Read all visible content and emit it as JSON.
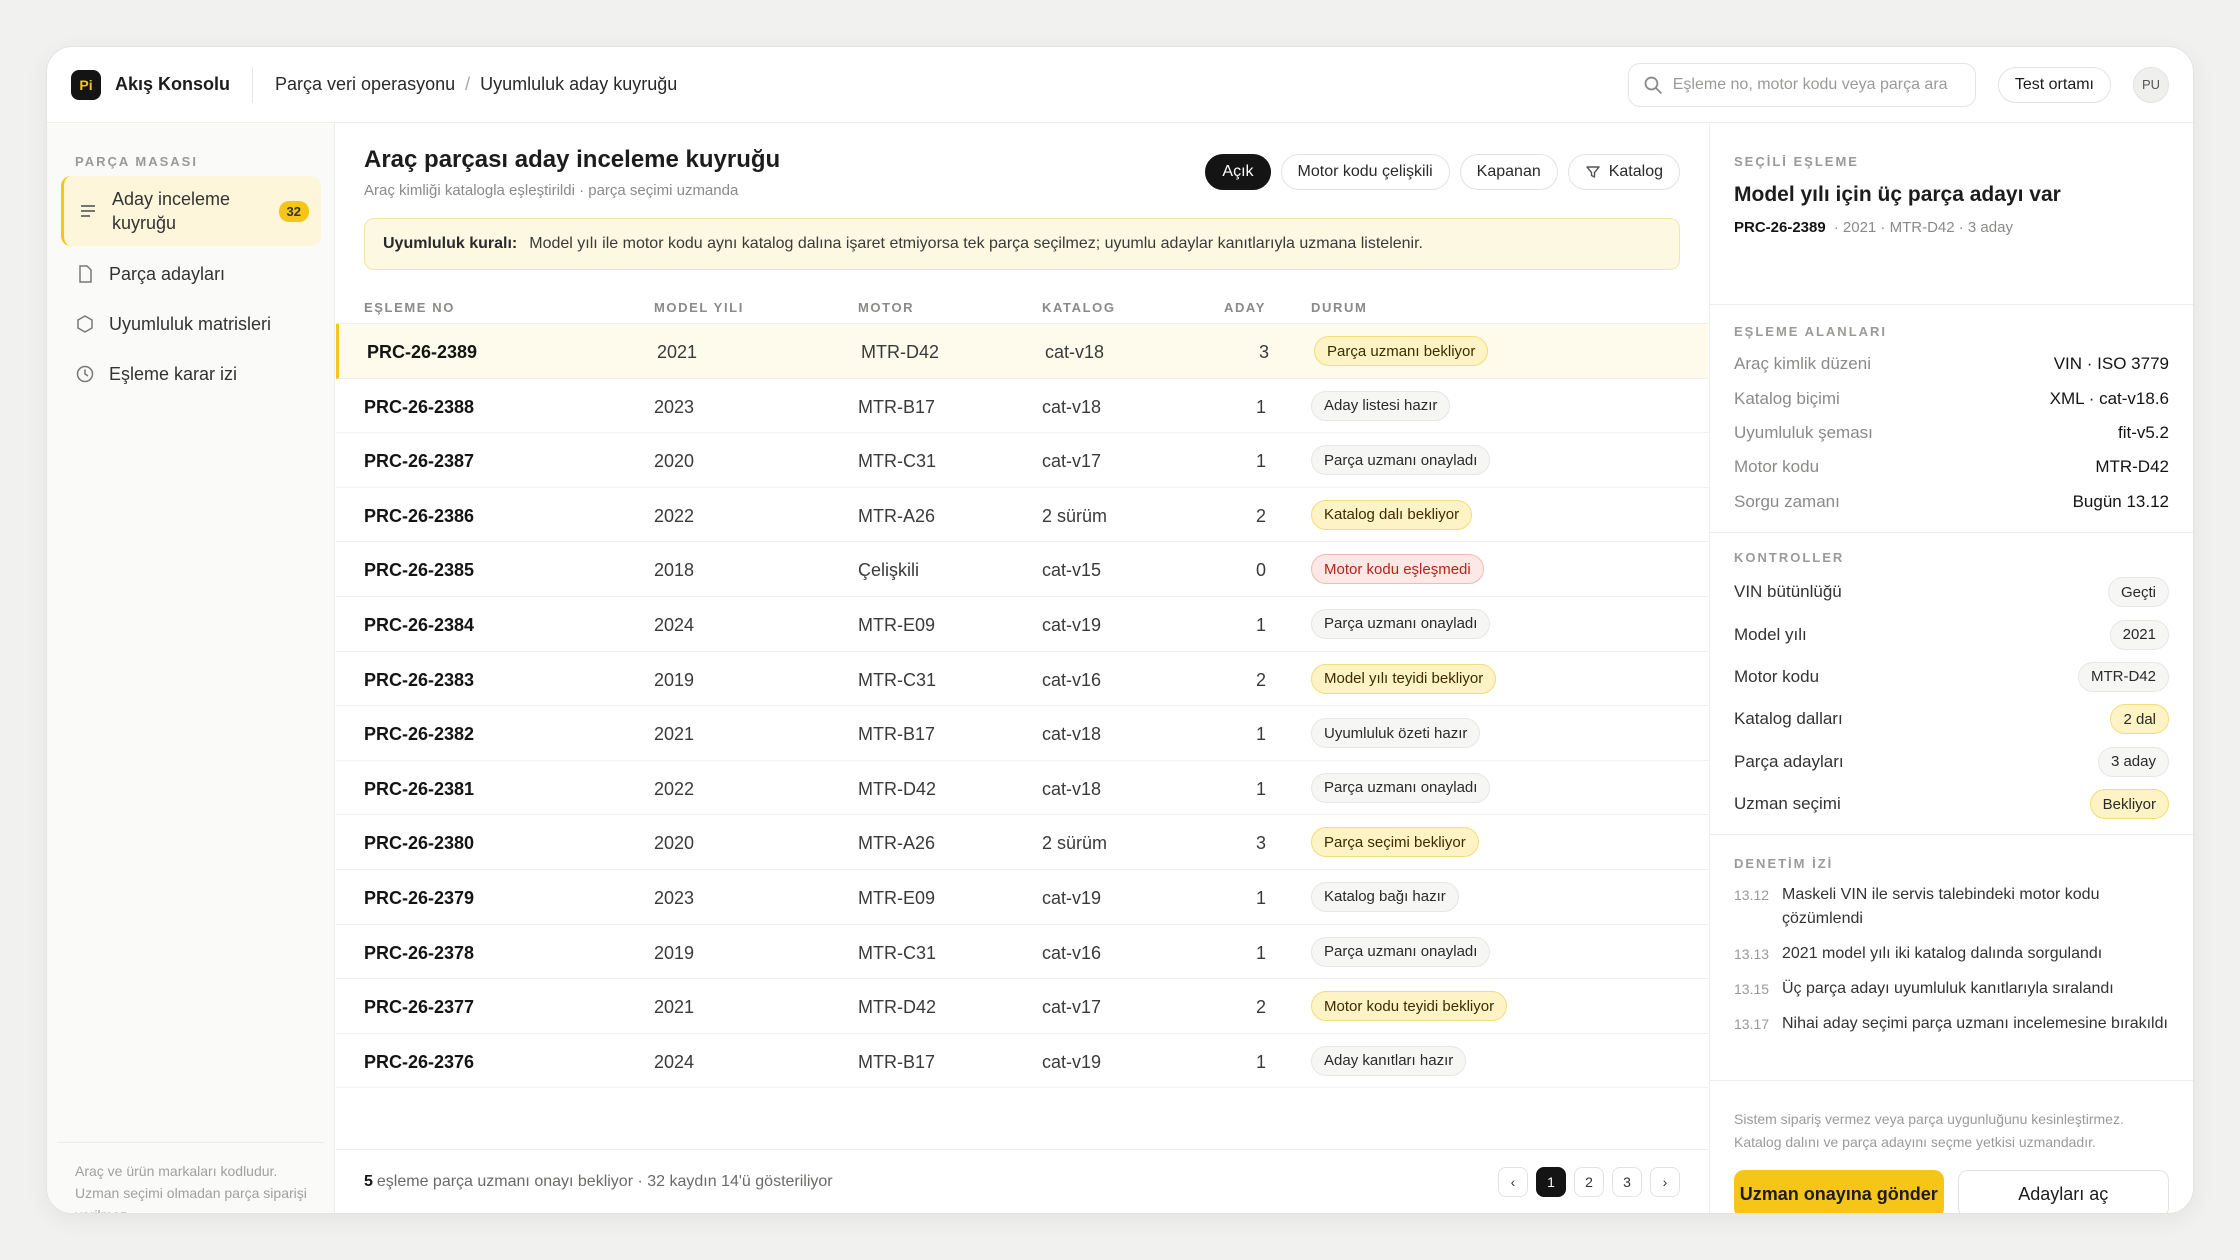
{
  "app": {
    "logo": "Pi",
    "name": "Akış Konsolu"
  },
  "breadcrumb": [
    "Parça veri operasyonu",
    "Uyumluluk aday kuyruğu"
  ],
  "search": {
    "placeholder": "Eşleme no, motor kodu veya parça ara"
  },
  "env_button": "Test ortamı",
  "avatar": "PU",
  "sidebar": {
    "heading": "PARÇA MASASI",
    "items": [
      {
        "label": "Aday inceleme kuyruğu",
        "badge": "32",
        "icon": "list-icon",
        "active": true
      },
      {
        "label": "Parça adayları",
        "icon": "document-icon"
      },
      {
        "label": "Uyumluluk matrisleri",
        "icon": "hexagon-icon"
      },
      {
        "label": "Eşleme karar izi",
        "icon": "clock-icon"
      }
    ],
    "footnote": "Araç ve ürün markaları kodludur. Uzman seçimi olmadan parça siparişi verilmez."
  },
  "main": {
    "title": "Araç parçası aday inceleme kuyruğu",
    "subtitle": "Araç kimliği katalogla eşleştirildi · parça seçimi uzmanda",
    "filters": [
      "Açık",
      "Motor kodu çelişkili",
      "Kapanan",
      "Katalog"
    ],
    "notice_label": "Uyumluluk kuralı:",
    "notice_text": "Model yılı ile motor kodu aynı katalog dalına işaret etmiyorsa tek parça seçilmez; uyumlu adaylar kanıtlarıyla uzmana listelenir.",
    "columns": [
      "EŞLEME NO",
      "MODEL YILI",
      "MOTOR",
      "KATALOG",
      "ADAY",
      "DURUM"
    ],
    "rows": [
      {
        "no": "PRC-26-2389",
        "year": "2021",
        "motor": "MTR-D42",
        "catalog": "cat-v18",
        "count": "3",
        "status": "Parça uzmanı bekliyor",
        "tone": "y"
      },
      {
        "no": "PRC-26-2388",
        "year": "2023",
        "motor": "MTR-B17",
        "catalog": "cat-v18",
        "count": "1",
        "status": "Aday listesi hazır",
        "tone": "n"
      },
      {
        "no": "PRC-26-2387",
        "year": "2020",
        "motor": "MTR-C31",
        "catalog": "cat-v17",
        "count": "1",
        "status": "Parça uzmanı onayladı",
        "tone": "n"
      },
      {
        "no": "PRC-26-2386",
        "year": "2022",
        "motor": "MTR-A26",
        "catalog": "2 sürüm",
        "count": "2",
        "status": "Katalog dalı bekliyor",
        "tone": "y"
      },
      {
        "no": "PRC-26-2385",
        "year": "2018",
        "motor": "Çelişkili",
        "catalog": "cat-v15",
        "count": "0",
        "status": "Motor kodu eşleşmedi",
        "tone": "r"
      },
      {
        "no": "PRC-26-2384",
        "year": "2024",
        "motor": "MTR-E09",
        "catalog": "cat-v19",
        "count": "1",
        "status": "Parça uzmanı onayladı",
        "tone": "n"
      },
      {
        "no": "PRC-26-2383",
        "year": "2019",
        "motor": "MTR-C31",
        "catalog": "cat-v16",
        "count": "2",
        "status": "Model yılı teyidi bekliyor",
        "tone": "y"
      },
      {
        "no": "PRC-26-2382",
        "year": "2021",
        "motor": "MTR-B17",
        "catalog": "cat-v18",
        "count": "1",
        "status": "Uyumluluk özeti hazır",
        "tone": "n"
      },
      {
        "no": "PRC-26-2381",
        "year": "2022",
        "motor": "MTR-D42",
        "catalog": "cat-v18",
        "count": "1",
        "status": "Parça uzmanı onayladı",
        "tone": "n"
      },
      {
        "no": "PRC-26-2380",
        "year": "2020",
        "motor": "MTR-A26",
        "catalog": "2 sürüm",
        "count": "3",
        "status": "Parça seçimi bekliyor",
        "tone": "y"
      },
      {
        "no": "PRC-26-2379",
        "year": "2023",
        "motor": "MTR-E09",
        "catalog": "cat-v19",
        "count": "1",
        "status": "Katalog bağı hazır",
        "tone": "n"
      },
      {
        "no": "PRC-26-2378",
        "year": "2019",
        "motor": "MTR-C31",
        "catalog": "cat-v16",
        "count": "1",
        "status": "Parça uzmanı onayladı",
        "tone": "n"
      },
      {
        "no": "PRC-26-2377",
        "year": "2021",
        "motor": "MTR-D42",
        "catalog": "cat-v17",
        "count": "2",
        "status": "Motor kodu teyidi bekliyor",
        "tone": "y"
      },
      {
        "no": "PRC-26-2376",
        "year": "2024",
        "motor": "MTR-B17",
        "catalog": "cat-v19",
        "count": "1",
        "status": "Aday kanıtları hazır",
        "tone": "n"
      }
    ],
    "footer_count": "5",
    "footer_text": "eşleme parça uzmanı onayı bekliyor · 32 kaydın 14'ü gösteriliyor",
    "pages": [
      "‹",
      "1",
      "2",
      "3",
      "›"
    ]
  },
  "detail": {
    "heading": "SEÇİLİ EŞLEME",
    "title": "Model yılı için üç parça adayı var",
    "id": "PRC-26-2389",
    "meta": "· 2021 · MTR-D42 · 3 aday",
    "fields_heading": "EŞLEME ALANLARI",
    "fields": [
      {
        "k": "Araç kimlik düzeni",
        "v": "VIN · ISO 3779"
      },
      {
        "k": "Katalog biçimi",
        "v": "XML · cat-v18.6"
      },
      {
        "k": "Uyumluluk şeması",
        "v": "fit-v5.2"
      },
      {
        "k": "Motor kodu",
        "v": "MTR-D42"
      },
      {
        "k": "Sorgu zamanı",
        "v": "Bugün 13.12"
      }
    ],
    "controls_heading": "KONTROLLER",
    "controls": [
      {
        "k": "VIN bütünlüğü",
        "v": "Geçti",
        "tone": "n"
      },
      {
        "k": "Model yılı",
        "v": "2021",
        "tone": "n"
      },
      {
        "k": "Motor kodu",
        "v": "MTR-D42",
        "tone": "n"
      },
      {
        "k": "Katalog dalları",
        "v": "2 dal",
        "tone": "y"
      },
      {
        "k": "Parça adayları",
        "v": "3 aday",
        "tone": "n"
      },
      {
        "k": "Uzman seçimi",
        "v": "Bekliyor",
        "tone": "y"
      }
    ],
    "audit_heading": "DENETİM İZİ",
    "audit": [
      {
        "t": "13.12",
        "x": "Maskeli VIN ile servis talebindeki motor kodu çözümlendi"
      },
      {
        "t": "13.13",
        "x": "2021 model yılı iki katalog dalında sorgulandı"
      },
      {
        "t": "13.15",
        "x": "Üç parça adayı uyumluluk kanıtlarıyla sıralandı"
      },
      {
        "t": "13.17",
        "x": "Nihai aday seçimi parça uzmanı incelemesine bırakıldı"
      }
    ],
    "disclaimer": "Sistem sipariş vermez veya parça uygunluğunu kesinleştirmez. Katalog dalını ve parça adayını seçme yetkisi uzmandadır.",
    "primary": "Uzman onayına gönder",
    "secondary": "Adayları aç"
  },
  "colors": {
    "accent": "#f5c518",
    "dark": "#141414",
    "warn_bg": "#fdf3c4",
    "error": "#b42318"
  }
}
